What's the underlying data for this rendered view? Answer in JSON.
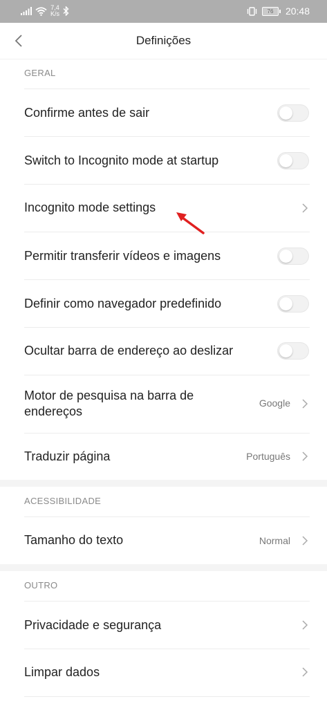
{
  "status_bar": {
    "net_speed_value": "7,4",
    "net_speed_unit": "K/s",
    "battery": "76",
    "time": "20:48"
  },
  "header": {
    "title": "Definições"
  },
  "sections": {
    "geral": "GERAL",
    "acessibilidade": "ACESSIBILIDADE",
    "outro": "OUTRO"
  },
  "rows": {
    "confirm_exit": "Confirme antes de sair",
    "incognito_startup": "Switch to Incognito mode at startup",
    "incognito_settings": "Incognito mode settings",
    "allow_transfer": "Permitir transferir vídeos e imagens",
    "default_browser": "Definir como navegador predefinido",
    "hide_address_bar": "Ocultar barra de endereço ao deslizar",
    "search_engine": "Motor de pesquisa na barra de endereços",
    "search_engine_value": "Google",
    "translate_page": "Traduzir página",
    "translate_page_value": "Português",
    "text_size": "Tamanho do texto",
    "text_size_value": "Normal",
    "privacy": "Privacidade e segurança",
    "clear_data": "Limpar dados"
  },
  "colors": {
    "status_bar_bg": "#aeaeae",
    "annotation_arrow": "#e02020"
  }
}
